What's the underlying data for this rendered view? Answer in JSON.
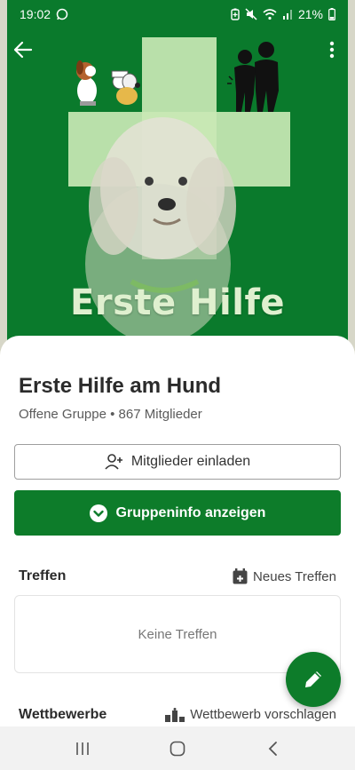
{
  "status_bar": {
    "time": "19:02",
    "battery": "21%",
    "icons": [
      "whatsapp-icon",
      "battery-saver-icon",
      "mute-icon",
      "wifi-icon",
      "signal-icon",
      "battery-icon"
    ]
  },
  "cover": {
    "title": "Erste Hilfe",
    "colors": {
      "background": "#0a7a2c",
      "cross": "#c9e8b5"
    }
  },
  "group": {
    "name": "Erste Hilfe am Hund",
    "meta": "Offene Gruppe • 867 Mitglieder"
  },
  "actions": {
    "invite_label": "Mitglieder einladen",
    "info_label": "Gruppeninfo anzeigen"
  },
  "meetings": {
    "title": "Treffen",
    "action_label": "Neues Treffen",
    "empty_text": "Keine Treffen"
  },
  "contests": {
    "title": "Wettbewerbe",
    "action_label": "Wettbewerb vorschlagen"
  },
  "colors": {
    "accent": "#0d7c2a",
    "nav_background": "#f2f2f2"
  }
}
